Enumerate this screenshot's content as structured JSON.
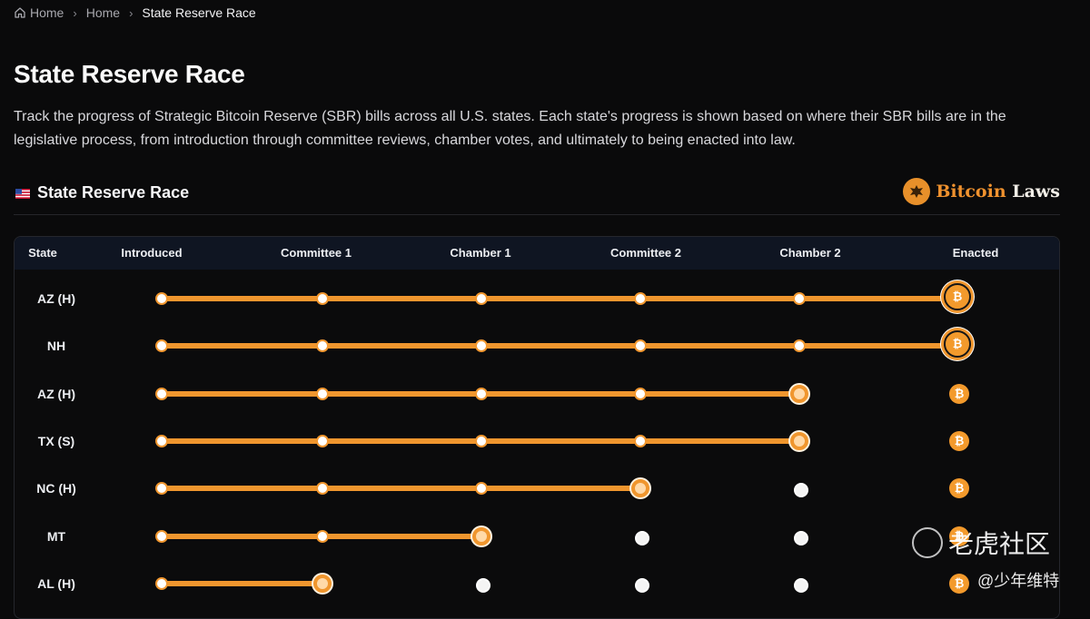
{
  "breadcrumb": {
    "items": [
      {
        "label": "Home",
        "icon": "home-icon"
      },
      {
        "label": "Home"
      },
      {
        "label": "State Reserve Race"
      }
    ]
  },
  "page": {
    "title": "State Reserve Race",
    "description": "Track the progress of Strategic Bitcoin Reserve (SBR) bills across all U.S. states. Each state's progress is shown based on where their SBR bills are in the legislative process, from introduction through committee reviews, chamber votes, and ultimately to being enacted into law."
  },
  "section": {
    "flag_icon": "us-flag-icon",
    "title": "State Reserve Race",
    "logo": {
      "text_accent": "Bitcoin",
      "text_plain": "Laws"
    }
  },
  "table": {
    "columns": [
      "State",
      "Introduced",
      "Committee 1",
      "Chamber 1",
      "Committee 2",
      "Chamber 2",
      "Enacted"
    ],
    "rows": [
      {
        "state": "AZ  (H)",
        "stage": 5
      },
      {
        "state": "NH",
        "stage": 5
      },
      {
        "state": "AZ  (H)",
        "stage": 4
      },
      {
        "state": "TX  (S)",
        "stage": 4
      },
      {
        "state": "NC  (H)",
        "stage": 3
      },
      {
        "state": "MT",
        "stage": 2
      },
      {
        "state": "AL  (H)",
        "stage": 1
      }
    ]
  },
  "watermark": {
    "title": "老虎社区",
    "subtitle": "@少年维特"
  },
  "colors": {
    "accent": "#f0962e",
    "background": "#0a0a0b",
    "header": "#0f1522"
  }
}
